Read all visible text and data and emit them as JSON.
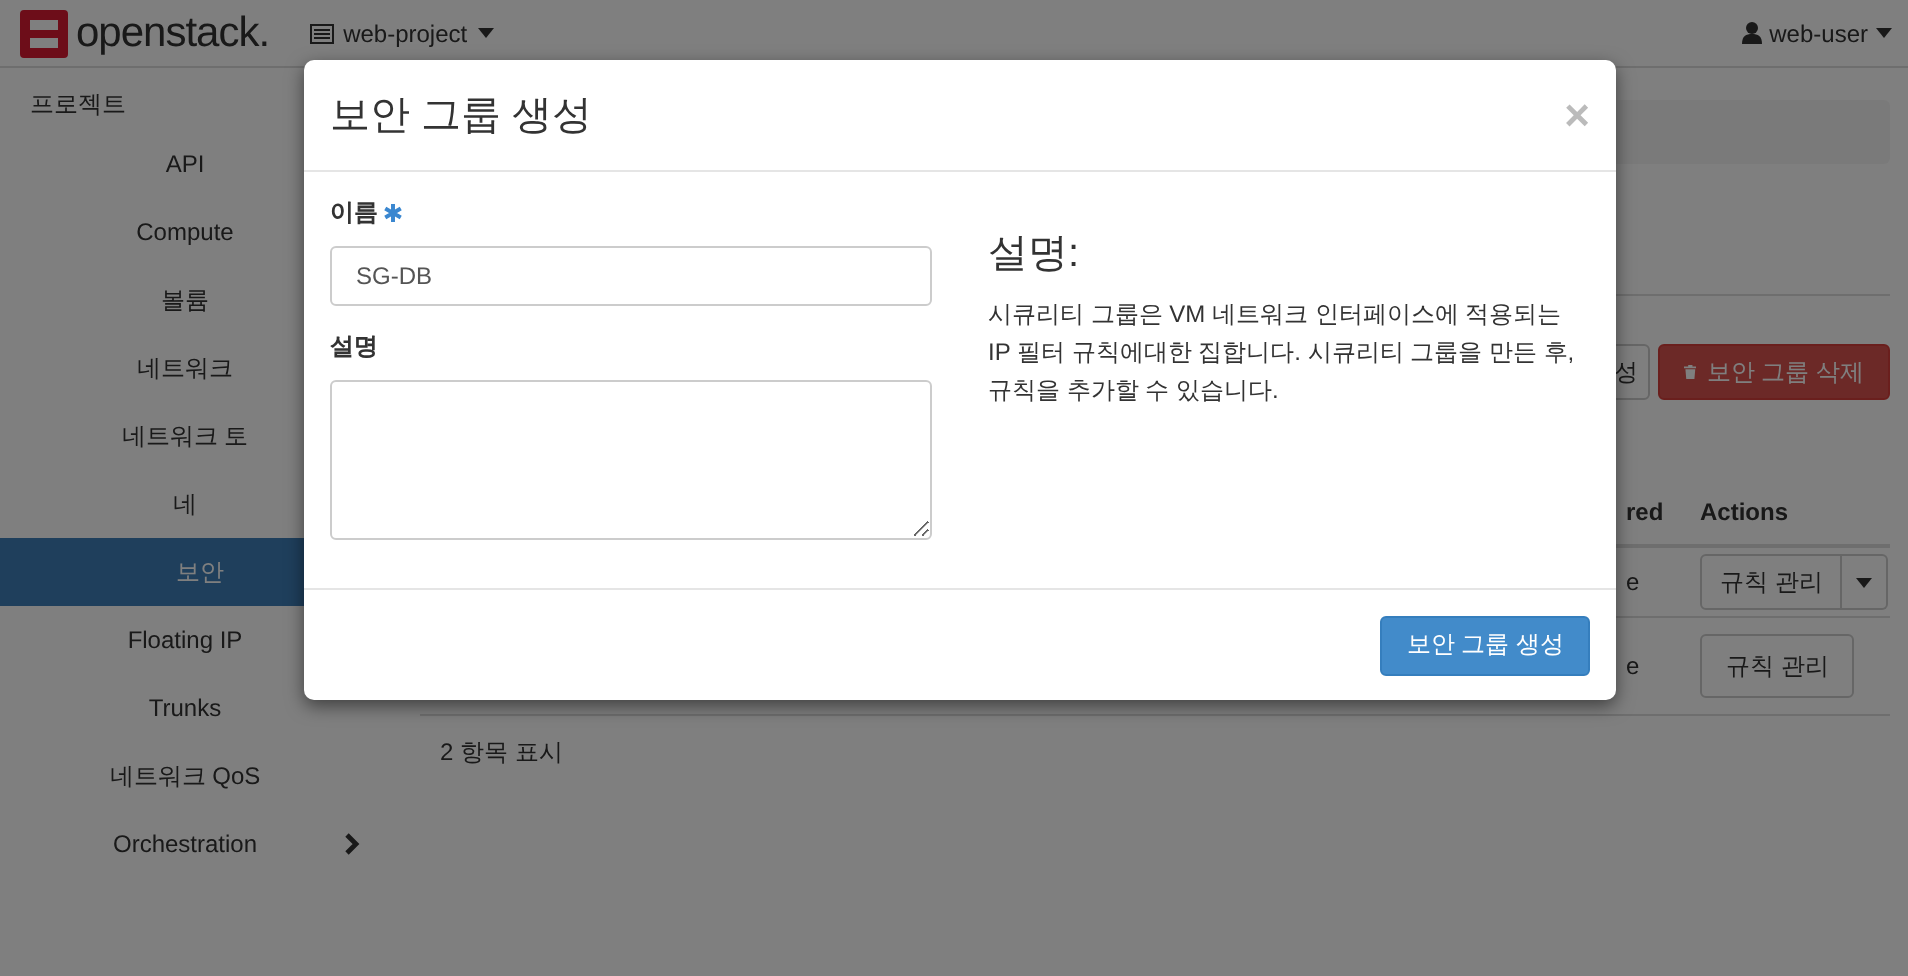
{
  "header": {
    "logo": "openstack.",
    "project": "web-project",
    "user": "web-user"
  },
  "sidebar": {
    "heading": "프로젝트",
    "items": [
      {
        "label": "API",
        "kind": "link",
        "selected": false
      },
      {
        "label": "Compute",
        "kind": "link",
        "selected": false
      },
      {
        "label": "볼륨",
        "kind": "link",
        "selected": false
      },
      {
        "label": "네트워크",
        "kind": "link",
        "selected": false
      },
      {
        "label": "네트워크 토",
        "kind": "link",
        "selected": false
      },
      {
        "label": "네",
        "kind": "link",
        "selected": false
      },
      {
        "label": "보안",
        "kind": "link",
        "selected": true
      },
      {
        "label": "Floating IP",
        "kind": "link",
        "selected": false
      },
      {
        "label": "Trunks",
        "kind": "link",
        "selected": false
      },
      {
        "label": "네트워크 QoS",
        "kind": "link",
        "selected": false
      },
      {
        "label": "Orchestration",
        "kind": "group",
        "selected": false
      }
    ]
  },
  "toolbar": {
    "buttons": [
      {
        "label": "성",
        "kind": "default"
      },
      {
        "label": "보안 그룹 삭제",
        "kind": "danger"
      }
    ]
  },
  "table": {
    "columns": [
      {
        "label": "red"
      },
      {
        "label": "Actions"
      }
    ],
    "rows": [
      {
        "column_3": "e",
        "action": "규칙 관리",
        "has_menu": true
      },
      {
        "column_3": "e",
        "action": "규칙 관리",
        "has_menu": false
      }
    ],
    "footer": "2 항목 표시"
  },
  "modal": {
    "title": "보안 그룹 생성",
    "close": "×",
    "fields": [
      {
        "label": "이름",
        "required": true,
        "kind": "text",
        "value": "SG-DB"
      },
      {
        "label": "설명",
        "required": false,
        "kind": "textarea"
      }
    ],
    "help": {
      "heading": "설명:",
      "text": "시큐리티 그룹은 VM 네트워크 인터페이스에 적용되는 IP 필터 규칙에대한 집합니다. 시큐리티 그룹을 만든 후, 규칙을 추가할 수 있습니다."
    },
    "submit": "보안 그룹 생성"
  }
}
